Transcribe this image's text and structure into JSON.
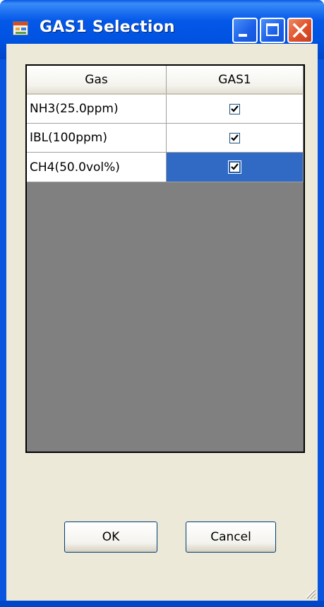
{
  "window": {
    "title": "GAS1 Selection",
    "icon": "app-window-icon",
    "buttons": [
      "minimize-icon",
      "maximize-icon",
      "close-icon"
    ]
  },
  "grid": {
    "columns": [
      "Gas",
      "GAS1"
    ],
    "rows": [
      {
        "gas": "NH3(25.0ppm)",
        "gas1_checked": true,
        "selected": false
      },
      {
        "gas": "IBL(100ppm)",
        "gas1_checked": true,
        "selected": false
      },
      {
        "gas": "CH4(50.0vol%)",
        "gas1_checked": true,
        "selected": true
      }
    ]
  },
  "buttons": {
    "ok_label": "OK",
    "cancel_label": "Cancel"
  },
  "colors": {
    "titlebar": "#0052e0",
    "client_bg": "#ece9d8",
    "grid_empty": "#808080",
    "selection": "#316ac5",
    "close_button": "#e0502a"
  }
}
